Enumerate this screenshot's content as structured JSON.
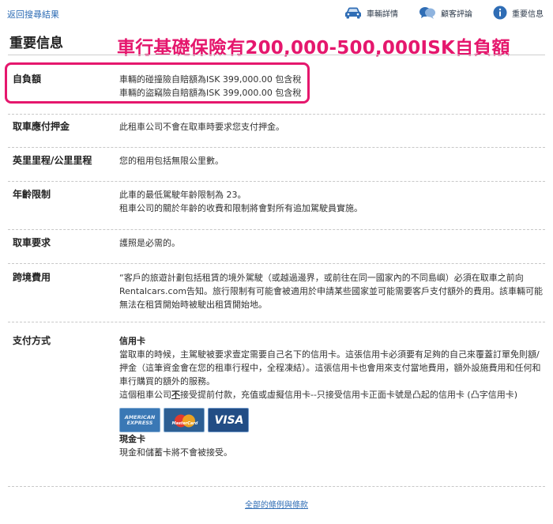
{
  "topbar": {
    "back_label": "返回搜尋結果",
    "nav": [
      {
        "icon": "car-icon",
        "label": "車輛詳情"
      },
      {
        "icon": "reviews-icon",
        "label": "顧客評論"
      },
      {
        "icon": "info-icon",
        "label": "重要信息"
      }
    ]
  },
  "section_title": "重要信息",
  "banner": "車行基礎保險有200,000-500,000ISK自負額",
  "colors": {
    "accent": "#e5176d",
    "link": "#2f6db5"
  },
  "rows": {
    "excess": {
      "label": "自負額",
      "lines": [
        "車輛的碰撞險自賠額為ISK 399,000.00 包含稅",
        "車輛的盜竊險自賠額為ISK 399,000.00 包含稅"
      ]
    },
    "deposit": {
      "label": "取車應付押金",
      "lines": [
        "此租車公司不會在取車時要求您支付押金。"
      ]
    },
    "mileage": {
      "label": "英里里程/公里里程",
      "lines": [
        "您的租用包括無限公里數。"
      ]
    },
    "age": {
      "label": "年齡限制",
      "lines": [
        "此車的最低駕駛年齡限制為 23。",
        "租車公司的關於年齡的收費和限制將會對所有追加駕駛員實施。"
      ]
    },
    "requirements": {
      "label": "取車要求",
      "lines": [
        "護照是必需的。"
      ]
    },
    "cross_border": {
      "label": "跨境費用",
      "text": "“客戶的旅遊計劃包括租賃的境外駕駛（或越過邊界，或前往在同一國家內的不同島嶼）必須在取車之前向Rentalcars.com告知。旅行限制有可能會被適用於申請某些國家並可能需要客戶支付額外的費用。該車輛可能無法在租賃開始時被駛出租賃開始地。"
    },
    "payment": {
      "label": "支付方式",
      "credit_head": "信用卡",
      "credit_text": "當取車的時候，主駕駛被要求壹定需要自己名下的信用卡。這張信用卡必須要有足夠的自己來覆蓋訂單免則額/押金（這筆資金會在您的租車行程中，全程凍結）。這張信用卡也會用來支付當地費用，額外設施費用和任何和車行購買的額外的服務。",
      "card_policy_pre": "這個租車公司",
      "card_policy_bold": "不",
      "card_policy_post": "接受提前付款，充值或虛擬信用卡--只接受信用卡正面卡號是凸起的信用卡 (凸字信用卡)",
      "cards": {
        "amex_line1": "AMERICAN",
        "amex_line2": "EXPRESS",
        "mastercard": "MasterCard",
        "visa": "VISA"
      },
      "cash_head": "現金卡",
      "cash_text": "現金和儲蓄卡將不會被接受。"
    }
  },
  "footer_link": "全部的條例與條款"
}
